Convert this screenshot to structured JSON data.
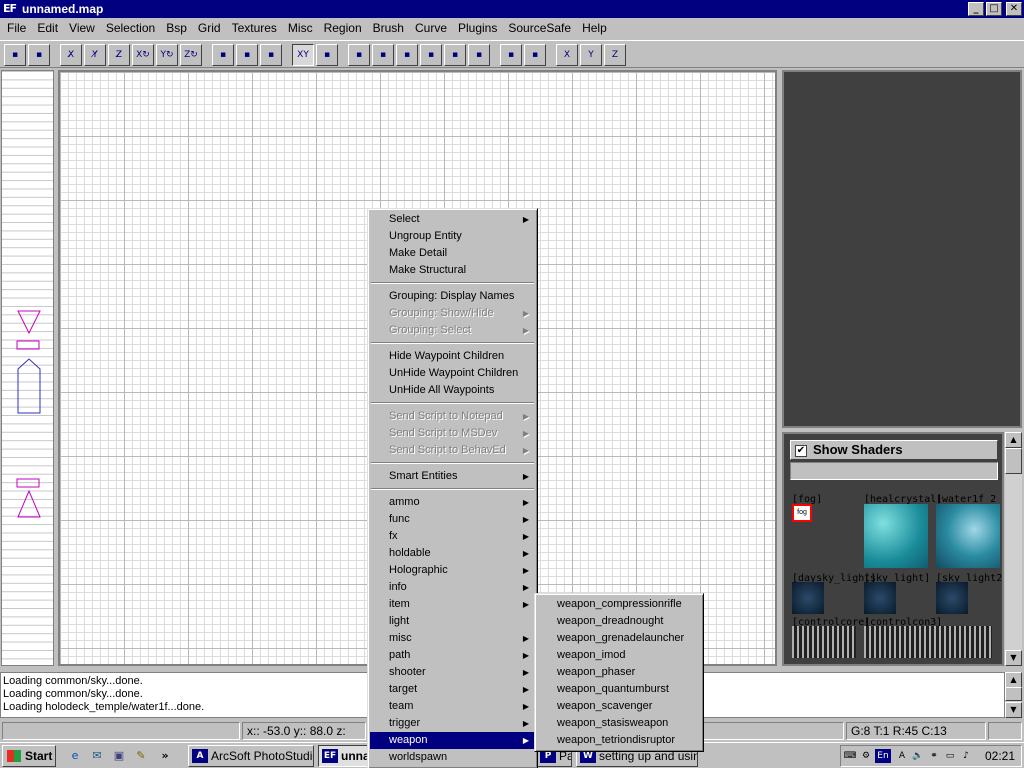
{
  "window": {
    "logo": "EF",
    "title": "unnamed.map"
  },
  "window_controls": {
    "minimize": "_",
    "maximize": "□",
    "close": "✕"
  },
  "menubar": [
    "File",
    "Edit",
    "View",
    "Selection",
    "Bsp",
    "Grid",
    "Textures",
    "Misc",
    "Region",
    "Brush",
    "Curve",
    "Plugins",
    "SourceSafe",
    "Help"
  ],
  "toolbar": [
    "open-icon",
    "save-icon",
    "flip-x-icon",
    "flip-y-icon",
    "flip-z-icon",
    "rotate-x-icon",
    "rotate-y-icon",
    "rotate-z-icon",
    "select-complete-icon",
    "select-inside-icon",
    "select-touching-icon",
    "view-change-icon",
    "texture-lock-icon",
    "clipper-icon",
    "edge-icon",
    "vertex-icon",
    "patch-icon",
    "show-entities-icon",
    "curve-icon",
    "camera-icon",
    "scale-icon",
    "x-axis-icon",
    "y-axis-icon",
    "z-axis-icon"
  ],
  "toolbar_glyphs": {
    "flip-x-icon": "X̸",
    "flip-y-icon": "Y̸",
    "flip-z-icon": "Z̸",
    "rotate-x-icon": "X↻",
    "rotate-y-icon": "Y↻",
    "rotate-z-icon": "Z↻",
    "x-axis-icon": "X",
    "y-axis-icon": "Y",
    "z-axis-icon": "Z",
    "view-change-icon": "XY"
  },
  "context_menu": {
    "items": [
      {
        "label": "Select",
        "submenu": true
      },
      {
        "label": "Ungroup Entity"
      },
      {
        "label": "Make Detail"
      },
      {
        "label": "Make Structural"
      },
      {
        "separator": true
      },
      {
        "label": "Grouping: Display Names"
      },
      {
        "label": "Grouping: Show/Hide",
        "submenu": true,
        "disabled": true
      },
      {
        "label": "Grouping: Select",
        "submenu": true,
        "disabled": true
      },
      {
        "separator": true
      },
      {
        "label": "Hide Waypoint Children"
      },
      {
        "label": "UnHide Waypoint Children"
      },
      {
        "label": "UnHide All Waypoints"
      },
      {
        "separator": true
      },
      {
        "label": "Send Script to Notepad",
        "submenu": true,
        "disabled": true
      },
      {
        "label": "Send Script to MSDev",
        "submenu": true,
        "disabled": true
      },
      {
        "label": "Send Script to BehavEd",
        "submenu": true,
        "disabled": true
      },
      {
        "separator": true
      },
      {
        "label": "Smart Entities",
        "submenu": true
      },
      {
        "separator": true
      },
      {
        "label": "ammo",
        "submenu": true
      },
      {
        "label": "func",
        "submenu": true
      },
      {
        "label": "fx",
        "submenu": true
      },
      {
        "label": "holdable",
        "submenu": true
      },
      {
        "label": "Holographic",
        "submenu": true
      },
      {
        "label": "info",
        "submenu": true
      },
      {
        "label": "item",
        "submenu": true
      },
      {
        "label": "light"
      },
      {
        "label": "misc",
        "submenu": true
      },
      {
        "label": "path",
        "submenu": true
      },
      {
        "label": "shooter",
        "submenu": true
      },
      {
        "label": "target",
        "submenu": true
      },
      {
        "label": "team",
        "submenu": true
      },
      {
        "label": "trigger",
        "submenu": true
      },
      {
        "label": "weapon",
        "submenu": true,
        "highlighted": true
      },
      {
        "label": "worldspawn"
      }
    ]
  },
  "weapon_submenu": [
    "weapon_compressionrifle",
    "weapon_dreadnought",
    "weapon_grenadelauncher",
    "weapon_imod",
    "weapon_phaser",
    "weapon_quantumburst",
    "weapon_scavenger",
    "weapon_stasisweapon",
    "weapon_tetriondisruptor"
  ],
  "texture_panel": {
    "show_shaders_label": "Show Shaders",
    "show_shaders_checked": "✔",
    "labels": [
      "[fog]",
      "[healcrystal]",
      "[water1f_2",
      "[daysky_light]",
      "[sky_light]",
      "[sky_light2",
      "[controlcore]",
      "[controlcon3]"
    ],
    "fog_thumb_text": "fog"
  },
  "console": [
    "Loading common/sky...done.",
    "Loading common/sky...done.",
    "Loading holodeck_temple/water1f...done."
  ],
  "status": {
    "coords": "x:: -53.0  y:: 88.0  z:",
    "grid": "G:8 T:1 R:45 C:13"
  },
  "taskbar": {
    "start": "Start",
    "tasks": [
      {
        "label": "ArcSoft PhotoStudio",
        "icon": "photostudio-icon",
        "glyph": "A"
      },
      {
        "label": "unnamed.map",
        "icon": "ef-radiant-icon",
        "glyph": "EF",
        "active": true
      },
      {
        "label": "Page",
        "icon": "page-icon",
        "glyph": "P"
      },
      {
        "label": "setting up and usin...",
        "icon": "word-icon",
        "glyph": "W"
      }
    ],
    "quick_launch_more": "»",
    "clock": "02:21",
    "language": "En"
  },
  "colors": {
    "titlebar": "#000080",
    "highlight": "#000080",
    "waypoint": "#c000c0",
    "selection_red": "#ff0000"
  }
}
